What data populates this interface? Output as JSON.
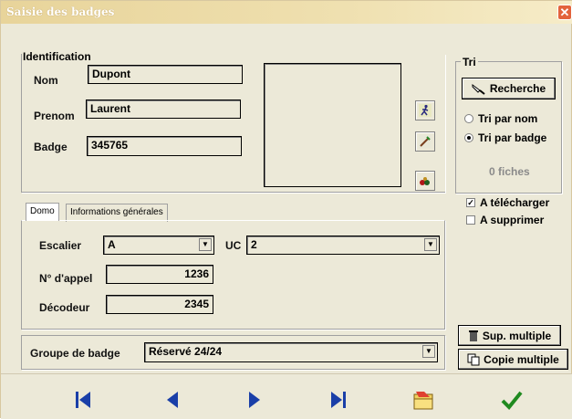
{
  "window": {
    "title": "Saisie des badges",
    "close_glyph": "✕"
  },
  "identification": {
    "group_title": "Identification",
    "nom_label": "Nom",
    "nom_value": "Dupont",
    "prenom_label": "Prenom",
    "prenom_value": "Laurent",
    "badge_label": "Badge",
    "badge_value": "345765"
  },
  "tri": {
    "group_title": "Tri",
    "search_label": "Recherche",
    "sort_by_name_label": "Tri par nom",
    "sort_by_badge_label": "Tri par badge",
    "selected_sort": "badge",
    "records_count_text": "0 fiches"
  },
  "flags": {
    "download_label": "A télécharger",
    "download_checked": true,
    "delete_label": "A supprimer",
    "delete_checked": false
  },
  "tabs": [
    {
      "label": "Domo",
      "active": true
    },
    {
      "label": "Informations générales",
      "active": false
    }
  ],
  "domo": {
    "escalier_label": "Escalier",
    "escalier_value": "A",
    "uc_label": "UC",
    "uc_value": "2",
    "appel_label": "N° d'appel",
    "appel_value": "1236",
    "decodeur_label": "Décodeur",
    "decodeur_value": "2345"
  },
  "groupe": {
    "label": "Groupe de badge",
    "value": "Réservé 24/24"
  },
  "actions": {
    "sup_multiple_label": "Sup. multiple",
    "copie_multiple_label": "Copie multiple"
  },
  "icons": {
    "combo_arrow": "▼",
    "check_mark": "✓"
  },
  "colors": {
    "accent_blue": "#1a3fa8",
    "check_green": "#1f8a1f",
    "title_bar": "#e8d49a"
  }
}
